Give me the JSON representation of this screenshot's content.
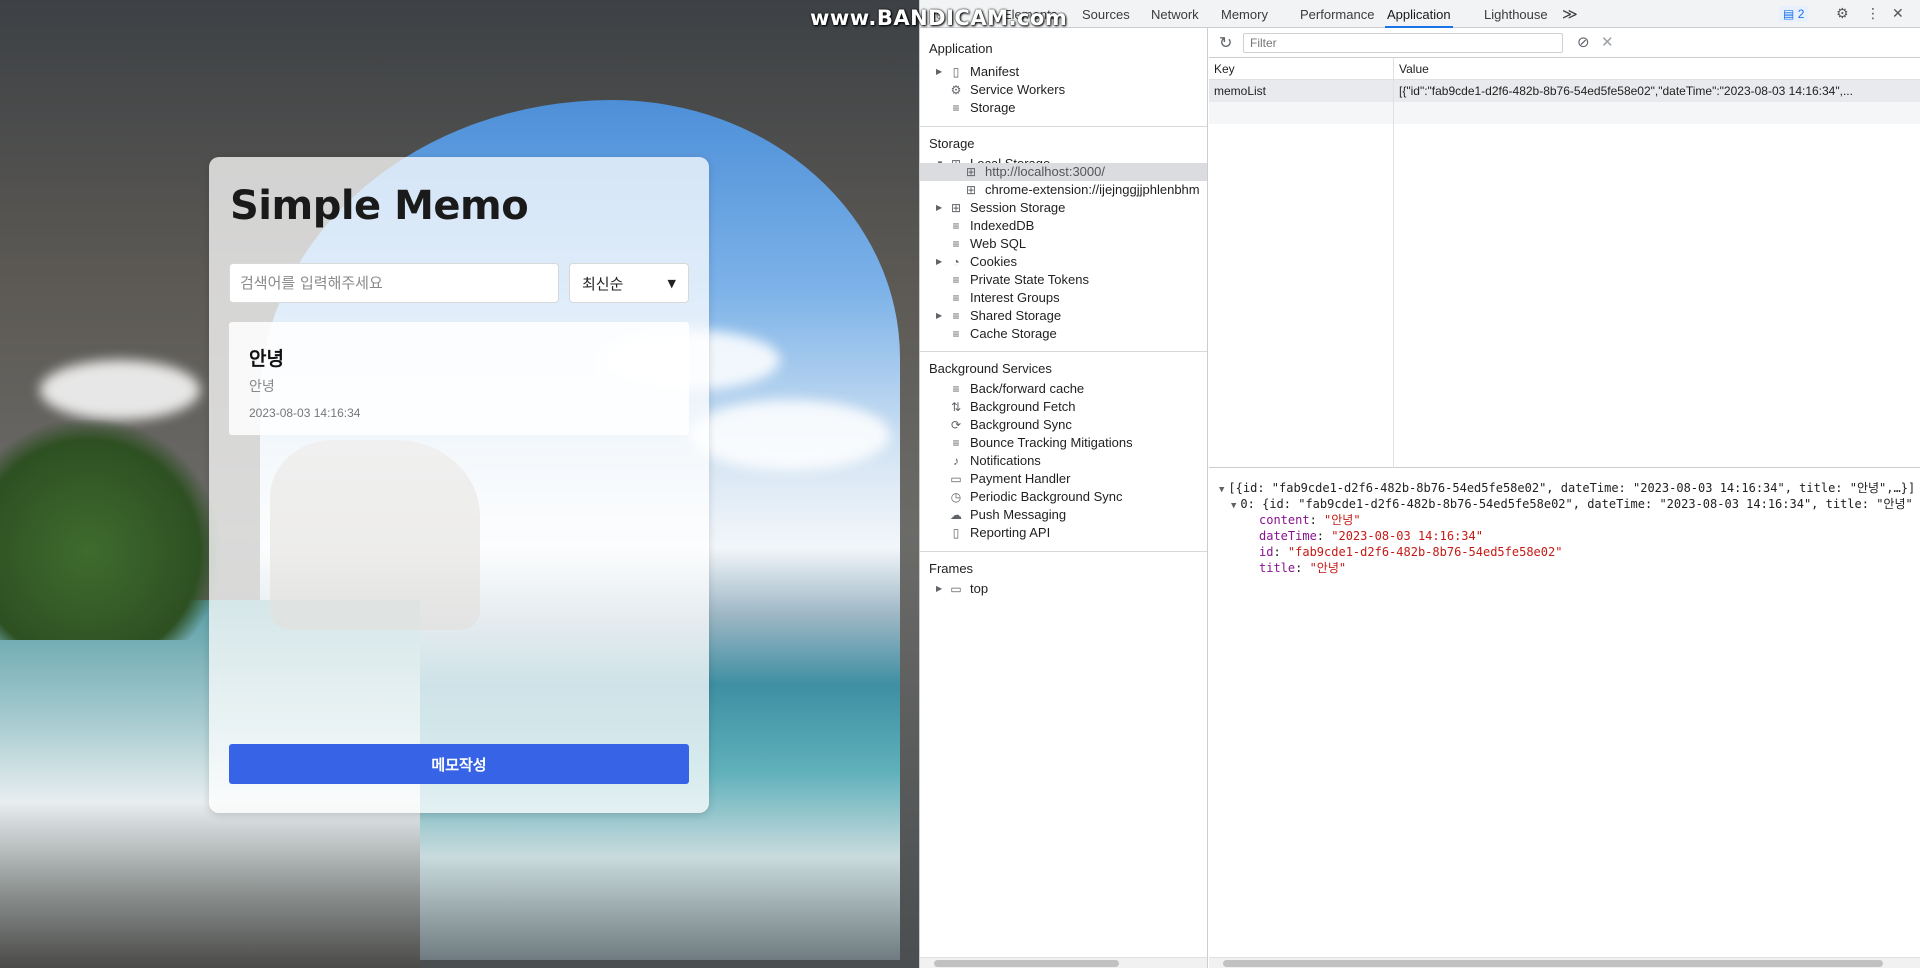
{
  "watermark": "www.BANDICAM.com",
  "app": {
    "title": "Simple Memo",
    "search_placeholder": "검색어를 입력해주세요",
    "sort_selected": "최신순",
    "memos": [
      {
        "title": "안녕",
        "content": "안녕",
        "date": "2023-08-03 14:16:34"
      }
    ],
    "write_button": "메모작성"
  },
  "devtools": {
    "tabs": [
      "Elements",
      "Sources",
      "Network",
      "Memory",
      "Performance",
      "Application",
      "Lighthouse"
    ],
    "active_tab": "Application",
    "partial_tab": "le",
    "more_tabs": "≫",
    "issues_count": "2",
    "sidebar": {
      "application_title": "Application",
      "application_items": [
        "Manifest",
        "Service Workers",
        "Storage"
      ],
      "storage_title": "Storage",
      "local_storage": "Local Storage",
      "local_storage_children": [
        "http://localhost:3000/",
        "chrome-extension://ijejnggjjphlenbhm"
      ],
      "storage_items": [
        "Session Storage",
        "IndexedDB",
        "Web SQL",
        "Cookies",
        "Private State Tokens",
        "Interest Groups",
        "Shared Storage",
        "Cache Storage"
      ],
      "background_title": "Background Services",
      "background_items": [
        "Back/forward cache",
        "Background Fetch",
        "Background Sync",
        "Bounce Tracking Mitigations",
        "Notifications",
        "Payment Handler",
        "Periodic Background Sync",
        "Push Messaging",
        "Reporting API"
      ],
      "frames_title": "Frames",
      "frames_items": [
        "top"
      ]
    },
    "filter_placeholder": "Filter",
    "table": {
      "key_header": "Key",
      "value_header": "Value",
      "rows": [
        {
          "key": "memoList",
          "value": "[{\"id\":\"fab9cde1-d2f6-482b-8b76-54ed5fe58e02\",\"dateTime\":\"2023-08-03 14:16:34\",..."
        }
      ]
    },
    "preview": {
      "line1": "[{id: \"fab9cde1-d2f6-482b-8b76-54ed5fe58e02\", dateTime: \"2023-08-03 14:16:34\", title: \"안녕\",…}]",
      "line2": "0: {id: \"fab9cde1-d2f6-482b-8b76-54ed5fe58e02\", dateTime: \"2023-08-03 14:16:34\", title: \"안녕\"",
      "fields": [
        {
          "key": "content",
          "value": "\"안녕\""
        },
        {
          "key": "dateTime",
          "value": "\"2023-08-03 14:16:34\""
        },
        {
          "key": "id",
          "value": "\"fab9cde1-d2f6-482b-8b76-54ed5fe58e02\""
        },
        {
          "key": "title",
          "value": "\"안녕\""
        }
      ]
    }
  }
}
